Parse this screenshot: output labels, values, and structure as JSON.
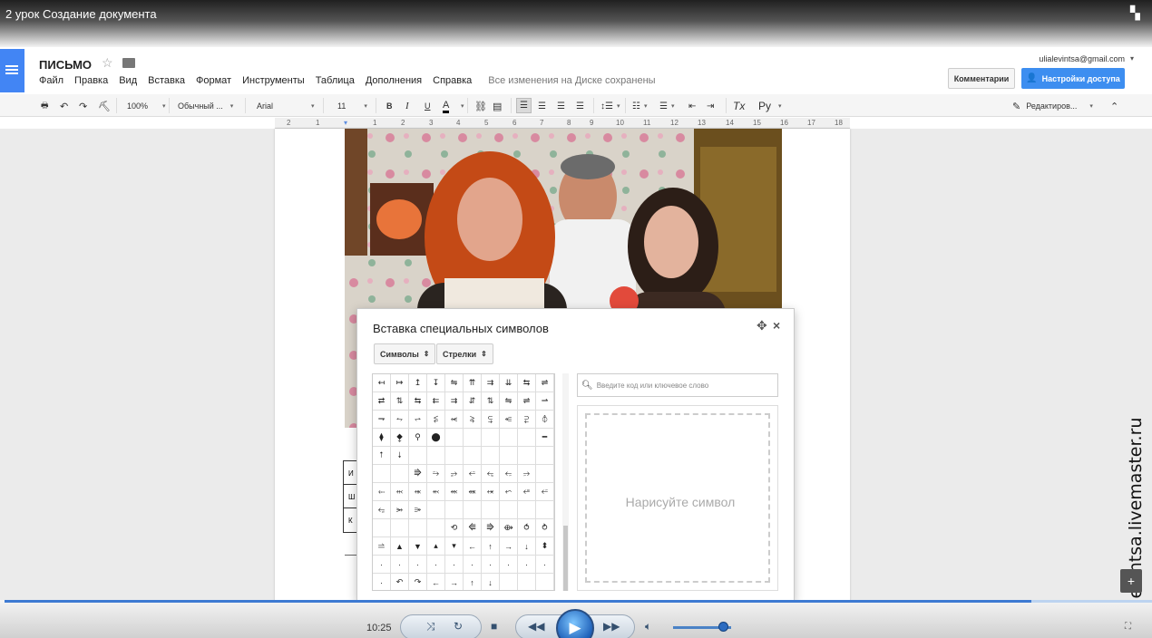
{
  "window": {
    "title": "2 урок Создание документа"
  },
  "doc": {
    "title": "ПИСЬМО",
    "menu": [
      "Файл",
      "Правка",
      "Вид",
      "Вставка",
      "Формат",
      "Инструменты",
      "Таблица",
      "Дополнения",
      "Справка"
    ],
    "saved_status": "Все изменения на Диске сохранены",
    "user_email": "ulialevintsa@gmail.com",
    "comments_button": "Комментарии",
    "share_button": "Настройки доступа"
  },
  "toolbar": {
    "zoom": "100%",
    "style": "Обычный ...",
    "font": "Arial",
    "size": "11",
    "bold": "B",
    "italic": "I",
    "underline": "U",
    "text_color": "A",
    "clear_format": "Tx",
    "language": "Ру",
    "mode": "Редактиров..."
  },
  "ruler": {
    "ticks": [
      "2",
      "1",
      "1",
      "2",
      "3",
      "4",
      "5",
      "6",
      "7",
      "8",
      "9",
      "10",
      "11",
      "12",
      "13",
      "14",
      "15",
      "16",
      "17",
      "18"
    ]
  },
  "table_left": [
    "И",
    "Ш",
    "К"
  ],
  "dialog": {
    "title": "Вставка специальных символов",
    "category": "Символы",
    "subcategory": "Стрелки",
    "search_placeholder": "Введите код или ключевое слово",
    "draw_label": "Нарисуйте символ",
    "symbols": [
      "↤",
      "↦",
      "↥",
      "↧",
      "⇋",
      "⇈",
      "⇉",
      "⇊",
      "⇆",
      "⇌",
      "⇄",
      "⇅",
      "⇆",
      "⇇",
      "⇉",
      "⇵",
      "⇅",
      "⇋",
      "⇌",
      "⇀",
      "⇁",
      "⥊",
      "⥋",
      "⥶",
      "⥷",
      "⥸",
      "⥹",
      "⥺",
      "⥻",
      "⦽",
      "⧫",
      "⧪",
      "⚲",
      "⬤",
      "",
      "",
      "",
      "",
      "",
      "━",
      "⭡",
      "⭣",
      "",
      "",
      "",
      "",
      "",
      "",
      "",
      "",
      "",
      "",
      "⭆",
      "⭇",
      "⭈",
      "⭉",
      "⭊",
      "⭋",
      "⭌",
      "",
      "⬸",
      "⬹",
      "⬺",
      "⬻",
      "⬼",
      "⬽",
      "⬾",
      "⬿",
      "⭀",
      "⭁",
      "⭂",
      "⭃",
      "⭄",
      "",
      "",
      "",
      "",
      "",
      "",
      "",
      "",
      "",
      "",
      "",
      "⟲",
      "⭅",
      "⭆",
      "⟴",
      "⥀",
      "⥁",
      "⥬",
      "▲",
      "▼",
      "▴",
      "▾",
      "←",
      "↑",
      "→",
      "↓",
      "⬍",
      "·",
      "·",
      "·",
      "·",
      "·",
      "·",
      "·",
      "·",
      "·",
      "·",
      "·",
      "↶",
      "↷",
      "←",
      "→",
      "↑",
      "↓",
      "",
      "",
      ""
    ]
  },
  "sidebar": {
    "watermark": "ulialevintsa.livemaster.ru",
    "add_icon": "+"
  },
  "player": {
    "time": "10:25",
    "progress_percent": 89,
    "volume_percent": 86
  }
}
